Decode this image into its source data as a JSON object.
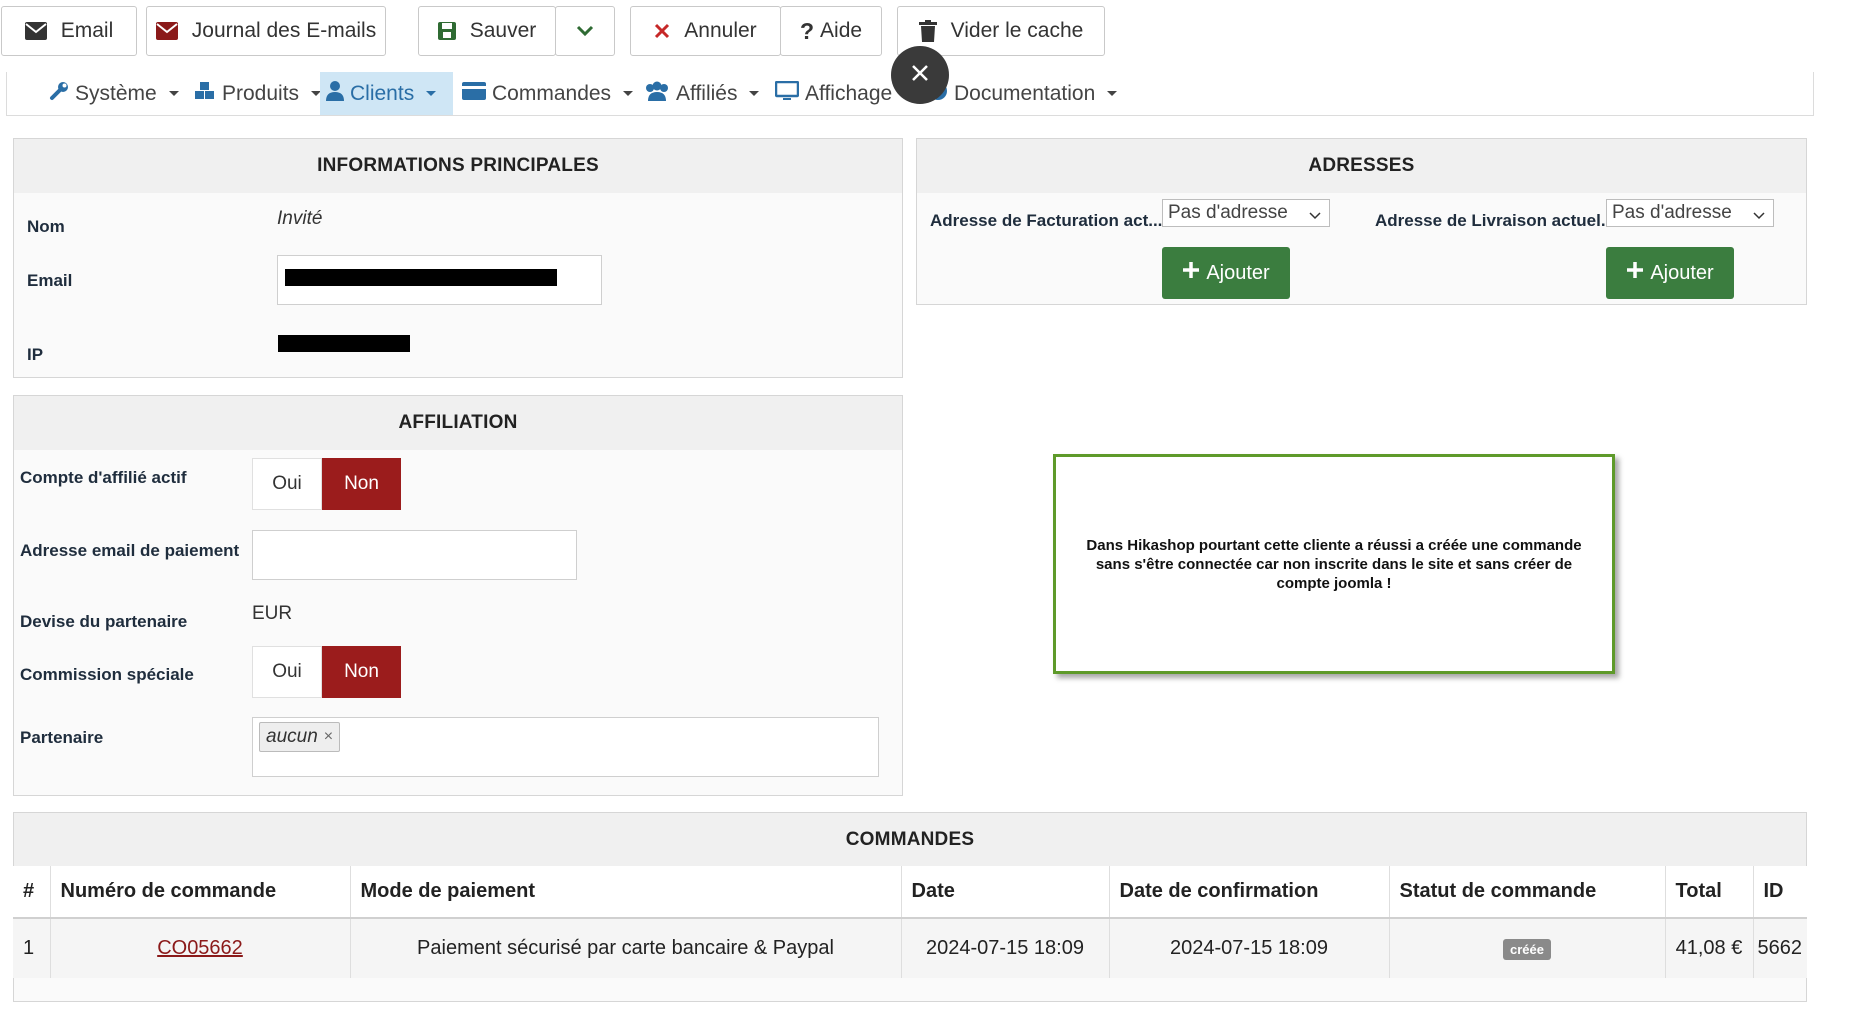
{
  "toolbar": {
    "email": "Email",
    "journal": "Journal des E-mails",
    "save": "Sauver",
    "cancel": "Annuler",
    "help": "Aide",
    "clear_cache": "Vider le cache"
  },
  "menu": {
    "items": [
      {
        "label": "Système",
        "icon": "wrench-icon"
      },
      {
        "label": "Produits",
        "icon": "cubes-icon"
      },
      {
        "label": "Clients",
        "icon": "user-icon",
        "active": true
      },
      {
        "label": "Commandes",
        "icon": "credit-card-icon"
      },
      {
        "label": "Affiliés",
        "icon": "users-icon"
      },
      {
        "label": "Affichage",
        "icon": "monitor-icon"
      },
      {
        "label": "Documentation",
        "icon": "globe-icon"
      }
    ]
  },
  "main_info": {
    "title": "INFORMATIONS PRINCIPALES",
    "name_label": "Nom",
    "name_value": "Invité",
    "email_label": "Email",
    "ip_label": "IP"
  },
  "affiliation": {
    "title": "AFFILIATION",
    "active_label": "Compte d'affilié actif",
    "payment_email_label": "Adresse email de paiement",
    "currency_label": "Devise du partenaire",
    "currency_value": "EUR",
    "special_commission_label": "Commission spéciale",
    "partner_label": "Partenaire",
    "partner_tag": "aucun",
    "yes": "Oui",
    "no": "Non"
  },
  "addresses": {
    "title": "ADRESSES",
    "billing_label": "Adresse de Facturation act...",
    "shipping_label": "Adresse de Livraison actuel..",
    "billing_select": "Pas d'adresse",
    "shipping_select": "Pas d'adresse",
    "add_label": "Ajouter"
  },
  "note": {
    "text": "Dans Hikashop pourtant cette cliente a réussi a créée une commande sans s'être connectée car non inscrite dans le site et sans créer de compte joomla !"
  },
  "orders": {
    "title": "COMMANDES",
    "headers": [
      "#",
      "Numéro de commande",
      "Mode de paiement",
      "Date",
      "Date de confirmation",
      "Statut de commande",
      "Total",
      "ID"
    ],
    "rows": [
      {
        "num": "1",
        "order": "CO05662",
        "payment": "Paiement sécurisé par carte bancaire & Paypal",
        "date": "2024-07-15 18:09",
        "confirm": "2024-07-15 18:09",
        "status": "créée",
        "total": "41,08 €",
        "id": "5662"
      }
    ]
  },
  "colors": {
    "danger": "#9b1c1c",
    "success": "#3b7d3f",
    "active_menu": "#cfe6f5",
    "note_border": "#5e9a2a"
  }
}
